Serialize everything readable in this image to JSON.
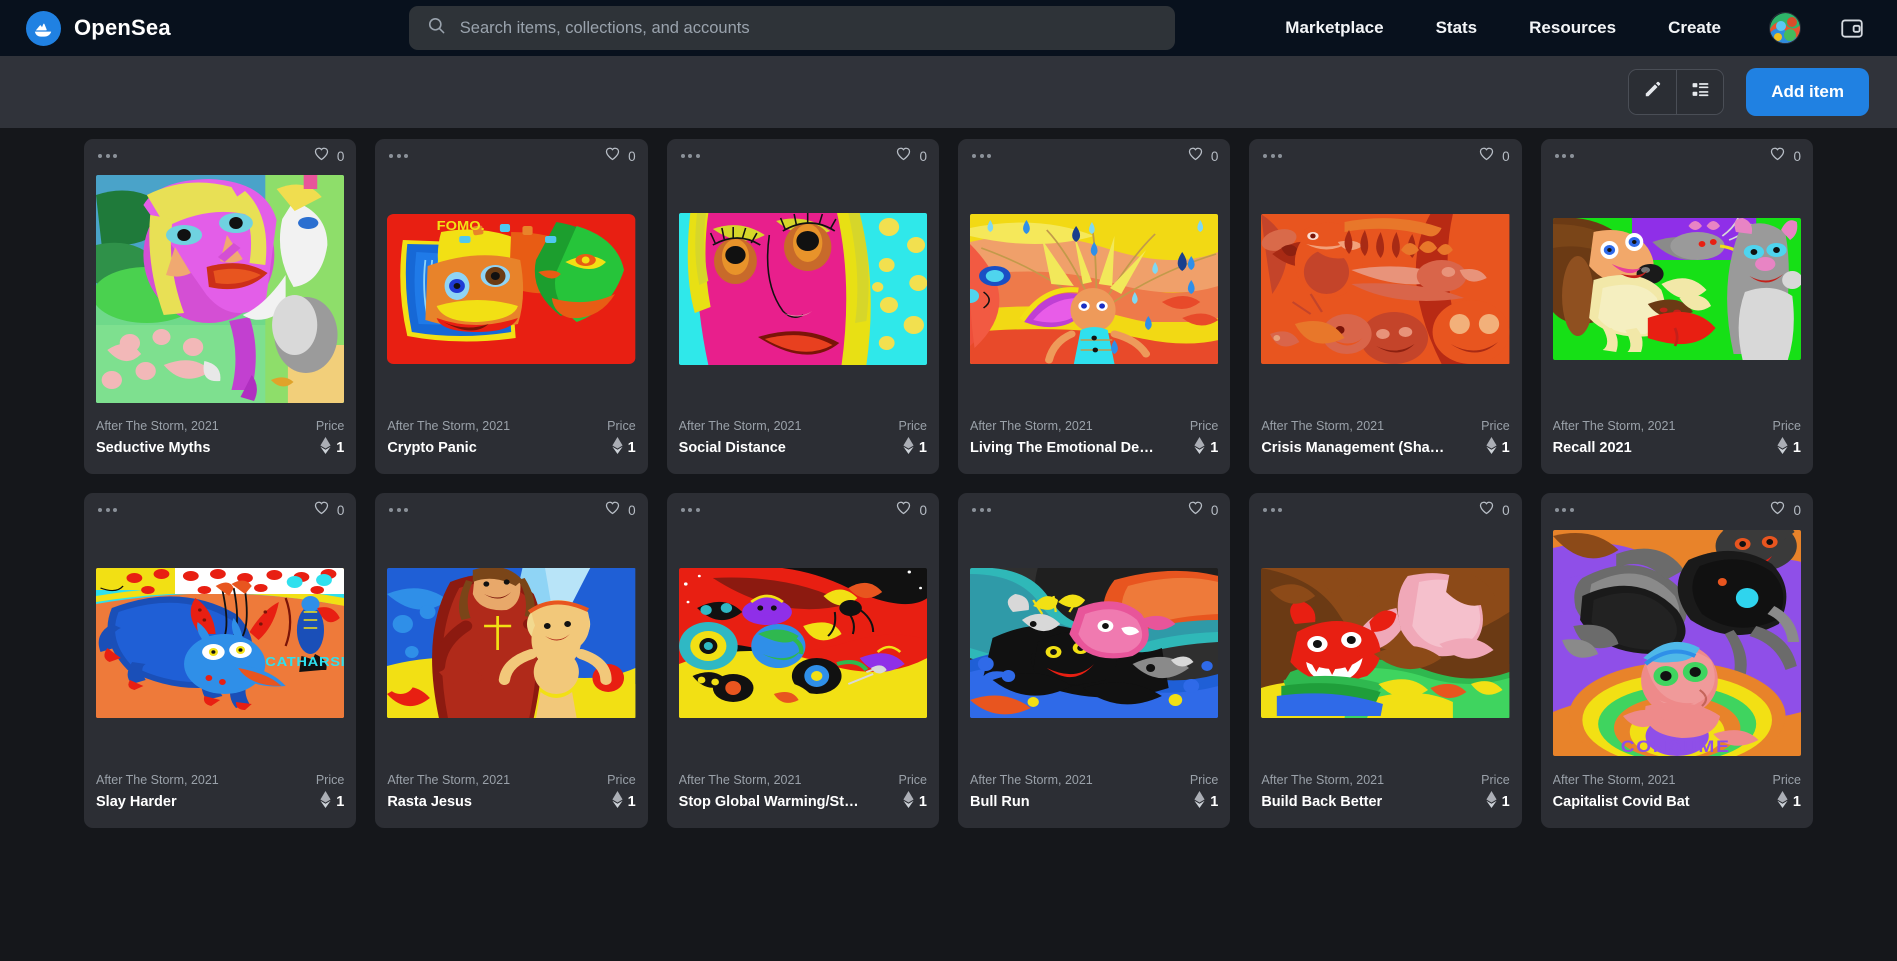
{
  "header": {
    "brand": "OpenSea",
    "logo_icon": "opensea-ship-icon",
    "search": {
      "placeholder": "Search items, collections, and accounts",
      "value": "",
      "icon": "search-icon"
    },
    "nav": [
      {
        "label": "Marketplace"
      },
      {
        "label": "Stats"
      },
      {
        "label": "Resources"
      },
      {
        "label": "Create"
      }
    ],
    "avatar_icon": "user-avatar",
    "wallet_icon": "wallet-icon",
    "accent_color": "#2081e2",
    "background_color": "#08111d"
  },
  "toolbar": {
    "edit_icon": "pencil-icon",
    "list_view_icon": "list-view-icon",
    "add_item_label": "Add item",
    "background_color": "#30333a"
  },
  "grid": {
    "price_label": "Price",
    "eth_icon": "ethereum-icon",
    "menu_icon": "ellipsis-icon",
    "like_icon": "heart-icon",
    "cards": [
      {
        "collection": "After The Storm, 2021",
        "title": "Seductive Myths",
        "price": "1",
        "likes": "0",
        "art": "seductive-myths"
      },
      {
        "collection": "After The Storm, 2021",
        "title": "Crypto Panic",
        "price": "1",
        "likes": "0",
        "art": "crypto-panic",
        "art_text": "FOMO."
      },
      {
        "collection": "After The Storm, 2021",
        "title": "Social Distance",
        "price": "1",
        "likes": "0",
        "art": "social-distance"
      },
      {
        "collection": "After The Storm, 2021",
        "title": "Living The Emotional Desert",
        "price": "1",
        "likes": "0",
        "art": "living-the-emotional-desert"
      },
      {
        "collection": "After The Storm, 2021",
        "title": "Crisis Management (Shad…",
        "price": "1",
        "likes": "0",
        "art": "crisis-management"
      },
      {
        "collection": "After The Storm, 2021",
        "title": "Recall 2021",
        "price": "1",
        "likes": "0",
        "art": "recall-2021"
      },
      {
        "collection": "After The Storm, 2021",
        "title": "Slay Harder",
        "price": "1",
        "likes": "0",
        "art": "slay-harder",
        "art_text": "CATHARSIS"
      },
      {
        "collection": "After The Storm, 2021",
        "title": "Rasta Jesus",
        "price": "1",
        "likes": "0",
        "art": "rasta-jesus"
      },
      {
        "collection": "After The Storm, 2021",
        "title": "Stop Global Warming/Sto…",
        "price": "1",
        "likes": "0",
        "art": "stop-global-warming"
      },
      {
        "collection": "After The Storm, 2021",
        "title": "Bull Run",
        "price": "1",
        "likes": "0",
        "art": "bull-run"
      },
      {
        "collection": "After The Storm, 2021",
        "title": "Build Back Better",
        "price": "1",
        "likes": "0",
        "art": "build-back-better"
      },
      {
        "collection": "After The Storm, 2021",
        "title": "Capitalist Covid Bat",
        "price": "1",
        "likes": "0",
        "art": "capitalist-covid-bat",
        "art_text": "CONSUME"
      }
    ]
  }
}
